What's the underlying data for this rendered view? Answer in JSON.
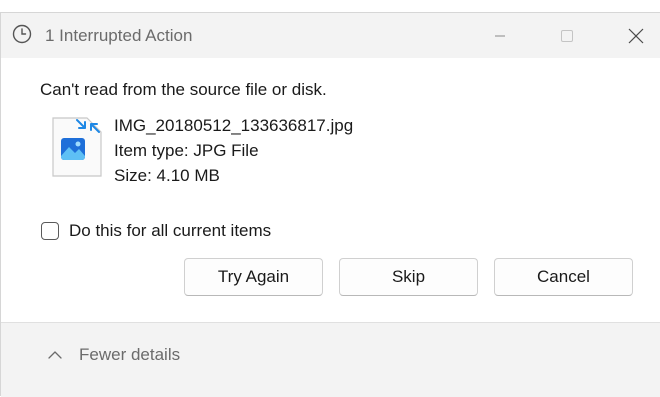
{
  "window": {
    "title": "1 Interrupted Action"
  },
  "dialog": {
    "message": "Can't read from the source file or disk.",
    "file": {
      "name": "IMG_20180512_133636817.jpg",
      "type": "Item type: JPG File",
      "size": "Size: 4.10 MB",
      "icon": "image-file-icon"
    },
    "checkbox": {
      "label": "Do this for all current items",
      "checked": false
    },
    "buttons": {
      "try_again": "Try Again",
      "skip": "Skip",
      "cancel": "Cancel"
    }
  },
  "footer": {
    "details_label": "Fewer details"
  },
  "colors": {
    "titlebar_bg": "#f3f3f3",
    "body_bg": "#ffffff",
    "icon_blue": "#1e88e5"
  }
}
